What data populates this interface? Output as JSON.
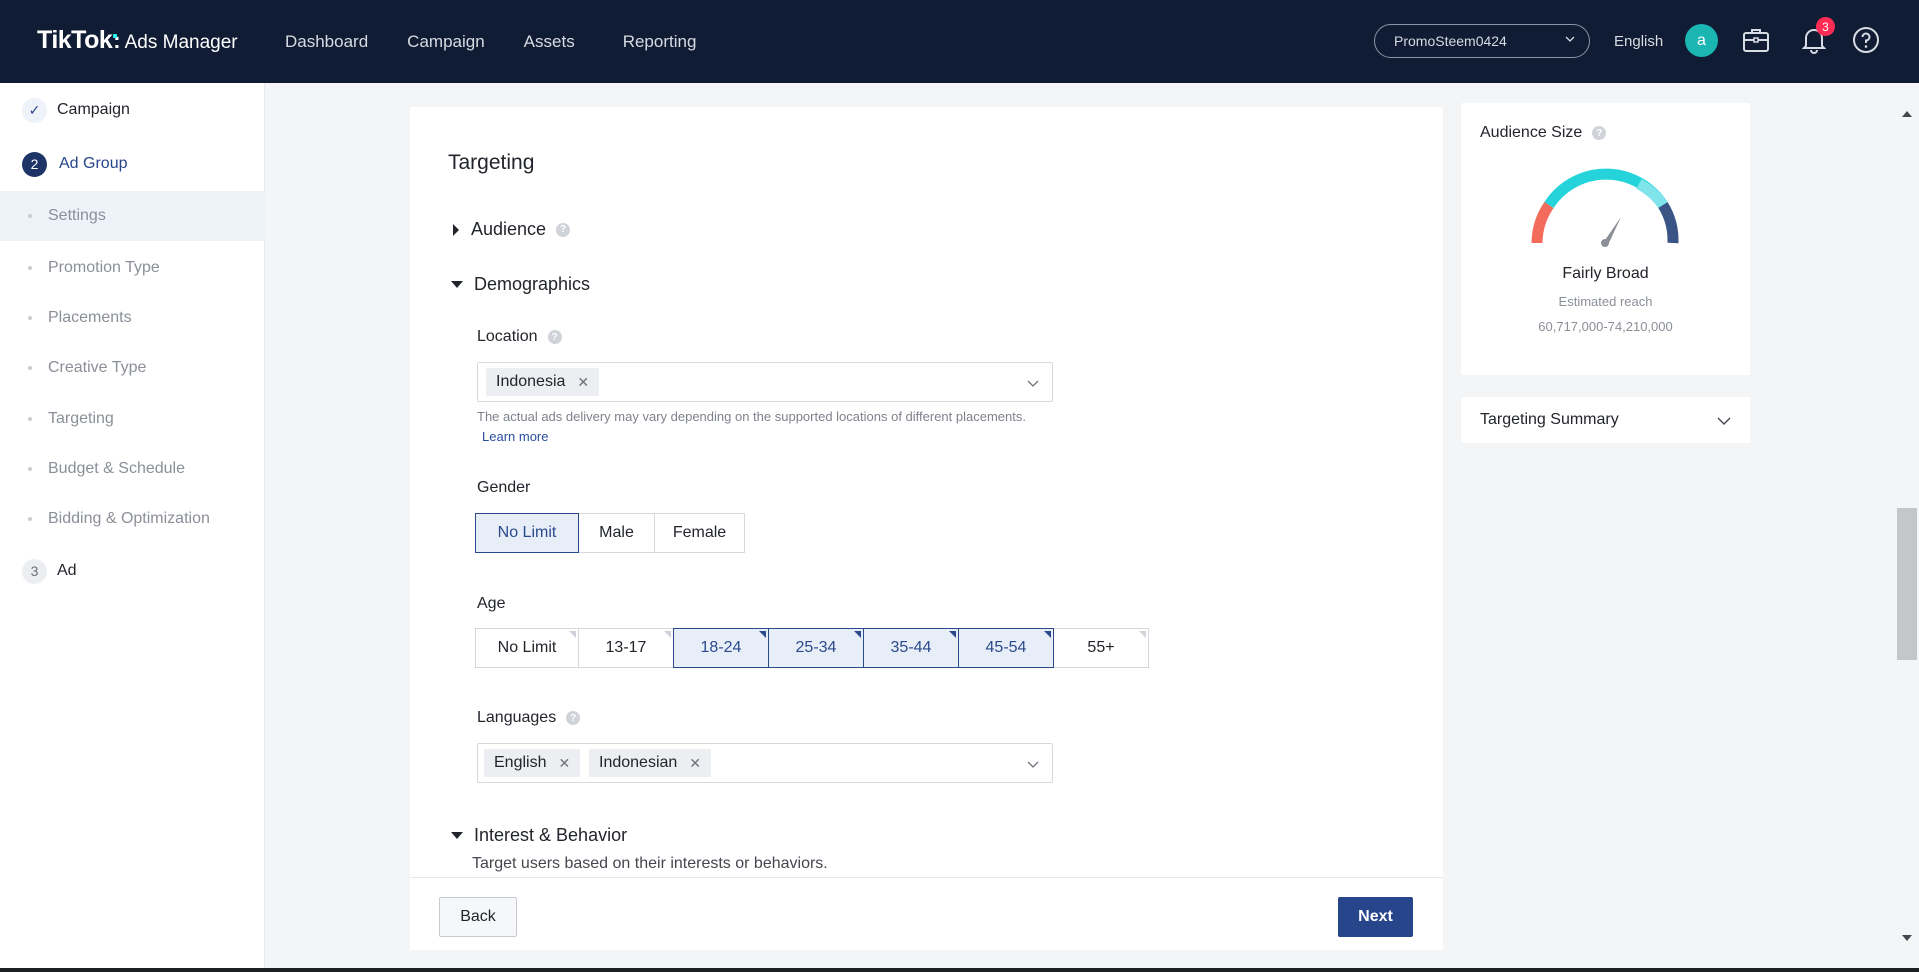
{
  "header": {
    "logo_brand": "TikTok",
    "logo_colon": ":",
    "logo_product": "Ads Manager",
    "nav": [
      "Dashboard",
      "Campaign",
      "Assets",
      "Reporting"
    ],
    "account": "PromoSteem0424",
    "language": "English",
    "avatar_letter": "a",
    "notification_count": "3"
  },
  "sidebar": {
    "steps": [
      {
        "label": "Campaign",
        "marker": "✓"
      },
      {
        "label": "Ad Group",
        "marker": "2"
      },
      {
        "label": "Ad",
        "marker": "3"
      }
    ],
    "sub_items": [
      "Settings",
      "Promotion Type",
      "Placements",
      "Creative Type",
      "Targeting",
      "Budget & Schedule",
      "Bidding & Optimization"
    ],
    "active_sub_item": "Settings"
  },
  "targeting": {
    "title": "Targeting",
    "audience_label": "Audience",
    "demographics_label": "Demographics",
    "location": {
      "label": "Location",
      "tags": [
        "Indonesia"
      ],
      "hint": "The actual ads delivery may vary depending on the supported locations of different placements.",
      "learn_more": "Learn more"
    },
    "gender": {
      "label": "Gender",
      "options": [
        "No Limit",
        "Male",
        "Female"
      ],
      "selected": "No Limit"
    },
    "age": {
      "label": "Age",
      "options": [
        "No Limit",
        "13-17",
        "18-24",
        "25-34",
        "35-44",
        "45-54",
        "55+"
      ],
      "selected": [
        "18-24",
        "25-34",
        "35-44",
        "45-54"
      ]
    },
    "languages": {
      "label": "Languages",
      "tags": [
        "English",
        "Indonesian"
      ]
    },
    "interest": {
      "label": "Interest & Behavior",
      "description": "Target users based on their interests or behaviors."
    }
  },
  "footer": {
    "back_label": "Back",
    "next_label": "Next"
  },
  "audience_size": {
    "title": "Audience Size",
    "level": "Fairly Broad",
    "reach_label": "Estimated reach",
    "reach_value": "60,717,000-74,210,000"
  },
  "targeting_summary": {
    "title": "Targeting Summary"
  },
  "colors": {
    "header_bg": "#0f1c33",
    "primary": "#27458a",
    "accent_teal": "#1bb5b2",
    "notification_red": "#fe2c55",
    "gauge_red": "#f26b5b",
    "gauge_teal": "#25d4da",
    "gauge_navy": "#3a5585"
  }
}
